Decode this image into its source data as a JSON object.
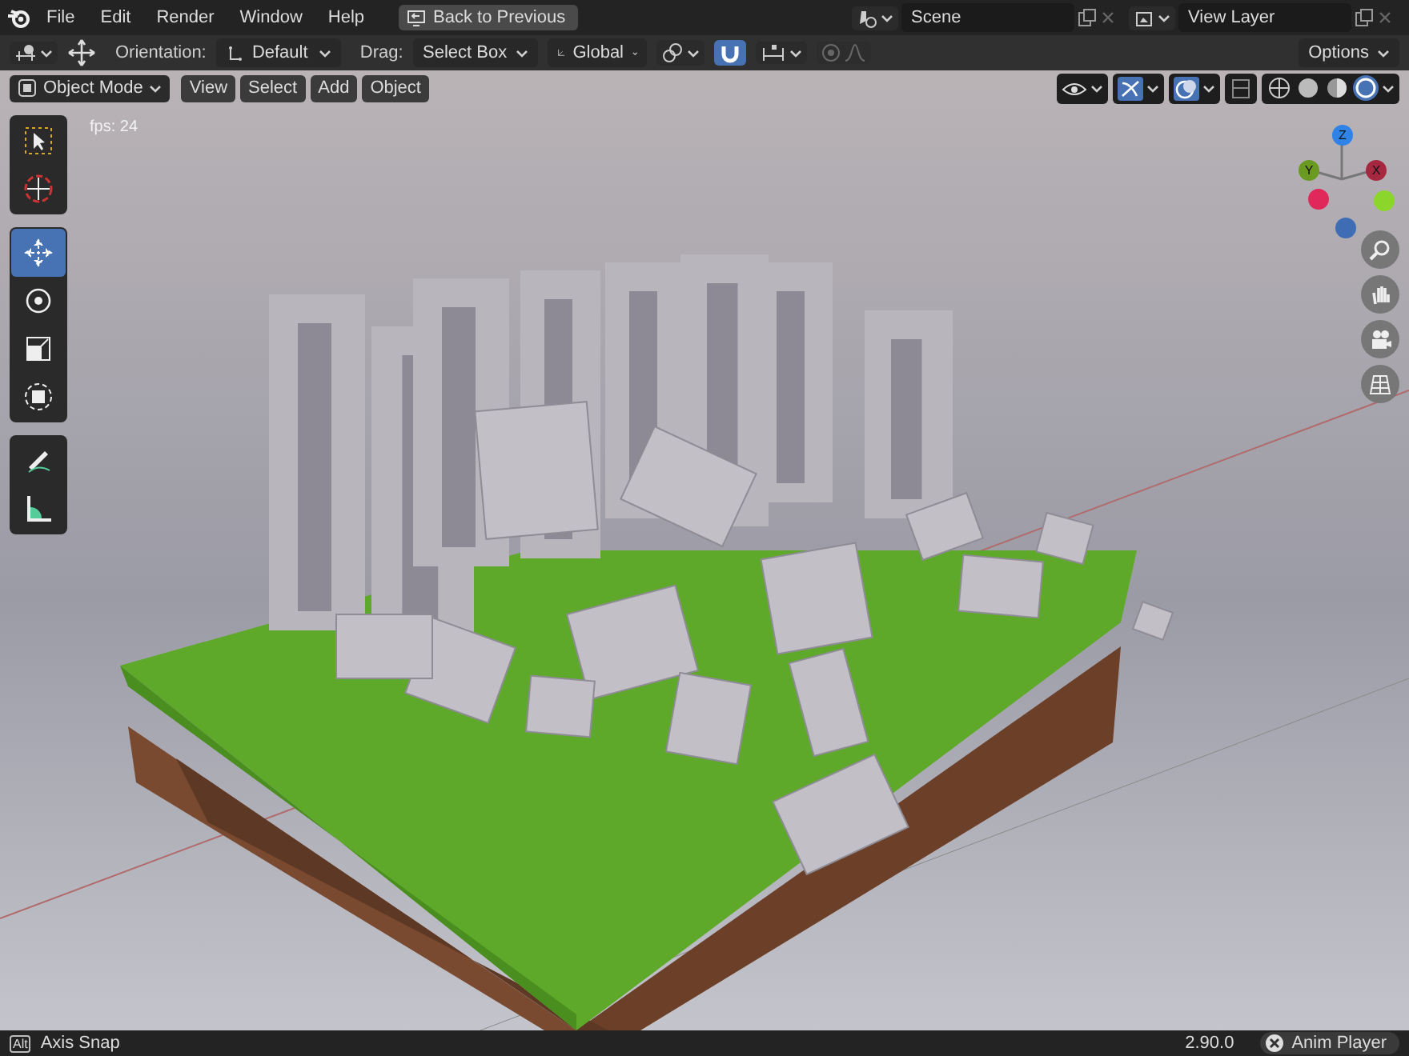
{
  "top_bar": {
    "menus": [
      "File",
      "Edit",
      "Render",
      "Window",
      "Help"
    ],
    "back_button": "Back to Previous",
    "scene": "Scene",
    "view_layer": "View Layer"
  },
  "tool_header": {
    "orientation_label": "Orientation:",
    "orientation": "Default",
    "drag_label": "Drag:",
    "drag": "Select Box",
    "transform_space": "Global",
    "snap_on": true,
    "proportional_editing_on": false,
    "options": "Options"
  },
  "viewport": {
    "mode": "Object Mode",
    "menus": [
      "View",
      "Select",
      "Add",
      "Object"
    ],
    "gizmos_on": true,
    "overlays_on": true,
    "xray_on": false,
    "shading": [
      {
        "kind": "wireframe",
        "selected": false
      },
      {
        "kind": "solid",
        "selected": false
      },
      {
        "kind": "material",
        "selected": false
      },
      {
        "kind": "rendered",
        "selected": true
      }
    ],
    "fps": "fps: 24",
    "toolbar": [
      {
        "tools": [
          {
            "kind": "select",
            "selected": false
          },
          {
            "kind": "cursor",
            "selected": false
          }
        ]
      },
      {
        "tools": [
          {
            "kind": "move",
            "selected": true
          },
          {
            "kind": "rotate",
            "selected": false
          },
          {
            "kind": "scale",
            "selected": false
          },
          {
            "kind": "transform",
            "selected": false
          }
        ]
      },
      {
        "tools": [
          {
            "kind": "annotate",
            "selected": false
          },
          {
            "kind": "measure",
            "selected": false
          }
        ]
      }
    ],
    "axes": [
      {
        "kind": "positive",
        "label": "Z",
        "color": "#2f83e6"
      },
      {
        "kind": "positive",
        "label": "Y",
        "color": "#6b9a22"
      },
      {
        "kind": "positive",
        "label": "X",
        "color": "#a52840"
      },
      {
        "kind": "negative",
        "color": "#e0285a"
      },
      {
        "kind": "negative",
        "color": "#8cd62c"
      },
      {
        "kind": "negative",
        "color": "#3e6db5"
      }
    ]
  },
  "status_bar": {
    "key": "Alt",
    "hint": "Axis Snap",
    "version": "2.90.0",
    "anim_player": "Anim Player"
  }
}
